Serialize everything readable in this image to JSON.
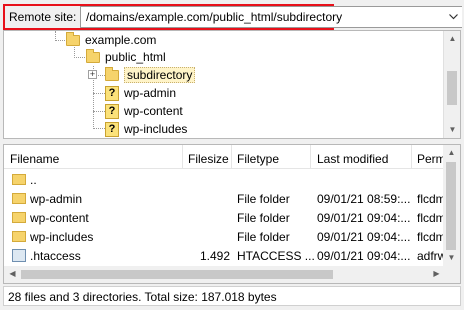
{
  "remote_site": {
    "label": "Remote site:",
    "path": "/domains/example.com/public_html/subdirectory",
    "dropdown_icon": "chevron-down-icon",
    "highlight_color": "#e8101a"
  },
  "tree": {
    "nodes": [
      {
        "label": "example.com",
        "icon": "folder-icon"
      },
      {
        "label": "public_html",
        "icon": "folder-icon"
      },
      {
        "label": "subdirectory",
        "icon": "folder-icon",
        "selected": true
      },
      {
        "label": "wp-admin",
        "icon": "unknown-folder-icon"
      },
      {
        "label": "wp-content",
        "icon": "unknown-folder-icon"
      },
      {
        "label": "wp-includes",
        "icon": "unknown-folder-icon"
      }
    ],
    "expander_symbol": "+",
    "unknown_glyph": "?"
  },
  "list": {
    "columns": [
      "Filename",
      "Filesize",
      "Filetype",
      "Last modified",
      "Perm"
    ],
    "rows": [
      {
        "name": "..",
        "size": "",
        "type": "",
        "modified": "",
        "perm": "",
        "icon": "folder-icon"
      },
      {
        "name": "wp-admin",
        "size": "",
        "type": "File folder",
        "modified": "09/01/21 08:59:...",
        "perm": "flcdm",
        "icon": "folder-icon"
      },
      {
        "name": "wp-content",
        "size": "",
        "type": "File folder",
        "modified": "09/01/21 09:04:...",
        "perm": "flcdm",
        "icon": "folder-icon"
      },
      {
        "name": "wp-includes",
        "size": "",
        "type": "File folder",
        "modified": "09/01/21 09:04:...",
        "perm": "flcdm",
        "icon": "folder-icon"
      },
      {
        "name": ".htaccess",
        "size": "1.492",
        "type": "HTACCESS ...",
        "modified": "09/01/21 09:04:...",
        "perm": "adfrw",
        "icon": "file-icon"
      }
    ]
  },
  "status": {
    "text": "28 files and 3 directories. Total size: 187.018 bytes"
  }
}
